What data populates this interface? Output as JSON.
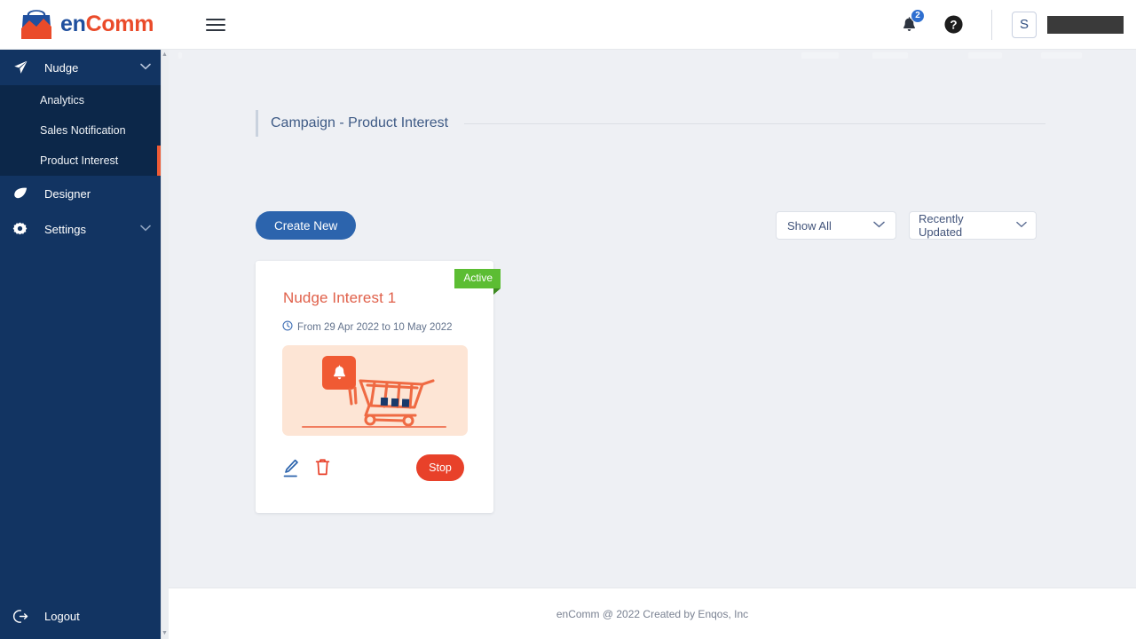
{
  "brand": {
    "part1": "en",
    "part2": "Comm",
    "logo_icon": "shopping-bag-logo"
  },
  "topbar": {
    "menu_icon": "hamburger-menu-icon",
    "notifications_icon": "bell-icon",
    "notifications_count": "2",
    "help_icon": "help-circle-icon",
    "avatar_initial": "S",
    "username_redacted": ""
  },
  "sidebar": {
    "nudge": {
      "label": "Nudge",
      "icon": "paper-plane-icon",
      "chevron": "chevron-down-icon",
      "expanded": true
    },
    "subitems": [
      {
        "label": "Analytics",
        "active": false
      },
      {
        "label": "Sales Notification",
        "active": false
      },
      {
        "label": "Product Interest",
        "active": true
      }
    ],
    "designer": {
      "label": "Designer",
      "icon": "leaf-icon"
    },
    "settings": {
      "label": "Settings",
      "icon": "gear-icon",
      "chevron": "chevron-down-icon"
    },
    "logout": {
      "label": "Logout",
      "icon": "logout-icon"
    },
    "active_indicator_color": "#ef5b35"
  },
  "page": {
    "title": "Campaign  - Product Interest"
  },
  "toolbar": {
    "create_label": "Create New",
    "filter_value": "Show All",
    "sort_value": "Recently Updated",
    "chevron_icon": "chevron-down-icon"
  },
  "campaign_card": {
    "status_badge": "Active",
    "status_color": "#5cbd33",
    "title": "Nudge Interest 1",
    "title_color": "#e0604a",
    "date_icon": "clock-icon",
    "date_text": "From 29 Apr 2022 to 10 May 2022",
    "thumbnail": {
      "bell_icon": "bell-icon",
      "cart_icon": "shopping-cart-icon",
      "background_color": "#fde5d5",
      "accent_color": "#f05a33"
    },
    "edit_icon": "pencil-edit-icon",
    "delete_icon": "trash-delete-icon",
    "action_label": "Stop",
    "action_color": "#e8412a"
  },
  "footer": {
    "text": "enComm @ 2022 Created by Enqos, Inc"
  }
}
